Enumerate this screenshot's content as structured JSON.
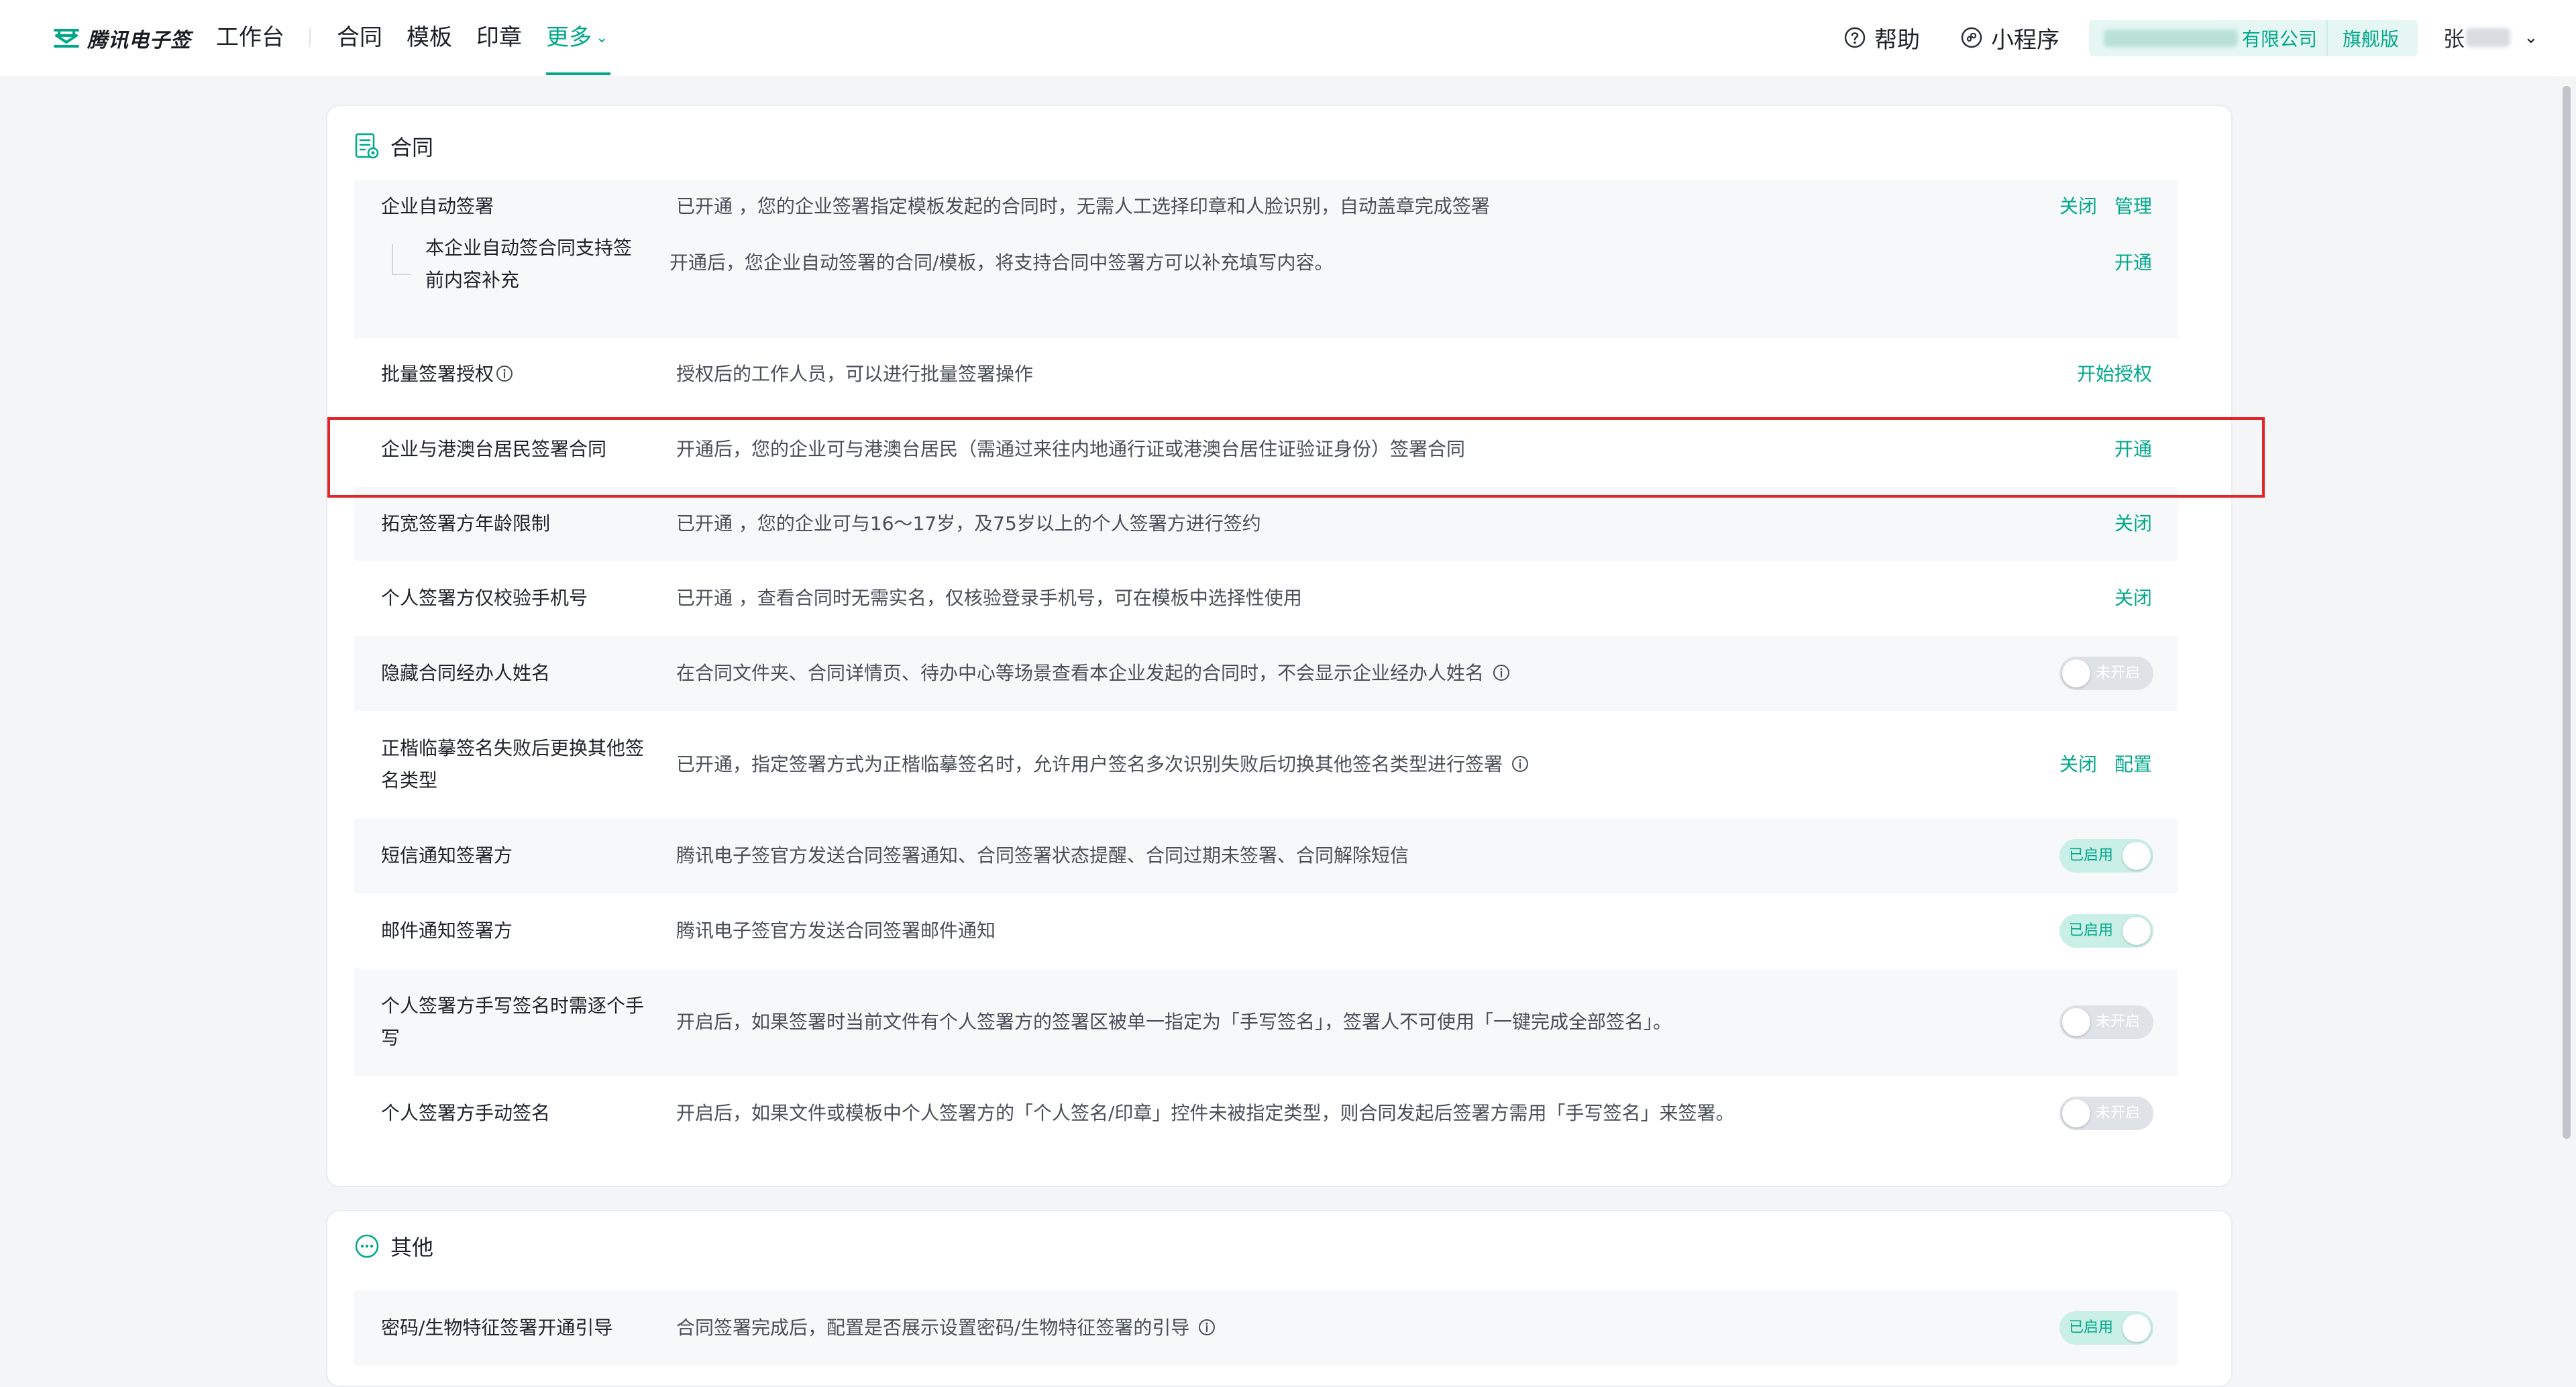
{
  "header": {
    "brand": "腾讯电子签",
    "nav": {
      "workbench": "工作台",
      "contract": "合同",
      "template": "模板",
      "seal": "印章",
      "more": "更多"
    },
    "help": "帮助",
    "mini_program": "小程序",
    "company_suffix": "有限公司",
    "edition": "旗舰版",
    "user_initial": "张"
  },
  "colors": {
    "accent": "#00a88a",
    "highlight": "#e0252b"
  },
  "sections": [
    {
      "title": "合同",
      "icon": "contract-doc-icon",
      "rows": [
        {
          "label": "企业自动签署",
          "desc": "已开通 ，您的企业签署指定模板发起的合同时，无需人工选择印章和人脸识别，自动盖章完成签署",
          "actions": [
            "关闭",
            "管理"
          ]
        },
        {
          "label": "本企业自动签合同支持签前内容补充",
          "desc": "开通后，您企业自动签署的合同/模板，将支持合同中签署方可以补充填写内容。",
          "actions": [
            "开通"
          ]
        },
        {
          "label": "批量签署授权",
          "desc": "授权后的工作人员，可以进行批量签署操作",
          "actions": [
            "开始授权"
          ]
        },
        {
          "label": "企业与港澳台居民签署合同",
          "desc": "开通后，您的企业可与港澳台居民（需通过来往内地通行证或港澳台居住证验证身份）签署合同",
          "actions": [
            "开通"
          ]
        },
        {
          "label": "拓宽签署方年龄限制",
          "desc": "已开通 ，您的企业可与16～17岁，及75岁以上的个人签署方进行签约",
          "actions": [
            "关闭"
          ]
        },
        {
          "label": "个人签署方仅校验手机号",
          "desc": "已开通 ，查看合同时无需实名，仅核验登录手机号，可在模板中选择性使用",
          "actions": [
            "关闭"
          ]
        },
        {
          "label": "隐藏合同经办人姓名",
          "desc": "在合同文件夹、合同详情页、待办中心等场景查看本企业发起的合同时，不会显示企业经办人姓名",
          "toggle": "未开启"
        },
        {
          "label": "正楷临摹签名失败后更换其他签名类型",
          "desc": "已开通，指定签署方式为正楷临摹签名时，允许用户签名多次识别失败后切换其他签名类型进行签署",
          "actions": [
            "关闭",
            "配置"
          ]
        },
        {
          "label": "短信通知签署方",
          "desc": "腾讯电子签官方发送合同签署通知、合同签署状态提醒、合同过期未签署、合同解除短信",
          "toggle": "已启用"
        },
        {
          "label": "邮件通知签署方",
          "desc": "腾讯电子签官方发送合同签署邮件通知",
          "toggle": "已启用"
        },
        {
          "label": "个人签署方手写签名时需逐个手写",
          "desc": "开启后，如果签署时当前文件有个人签署方的签署区被单一指定为「手写签名」，签署人不可使用「一键完成全部签名」。",
          "toggle": "未开启"
        },
        {
          "label": "个人签署方手动签名",
          "desc": "开启后，如果文件或模板中个人签署方的「个人签名/印章」控件未被指定类型，则合同发起后签署方需用「手写签名」来签署。",
          "toggle": "未开启"
        }
      ]
    },
    {
      "title": "其他",
      "icon": "more-dots-icon",
      "rows": [
        {
          "label": "密码/生物特征签署开通引导",
          "desc": "合同签署完成后，配置是否展示设置密码/生物特征签署的引导",
          "toggle": "已启用"
        }
      ]
    }
  ]
}
